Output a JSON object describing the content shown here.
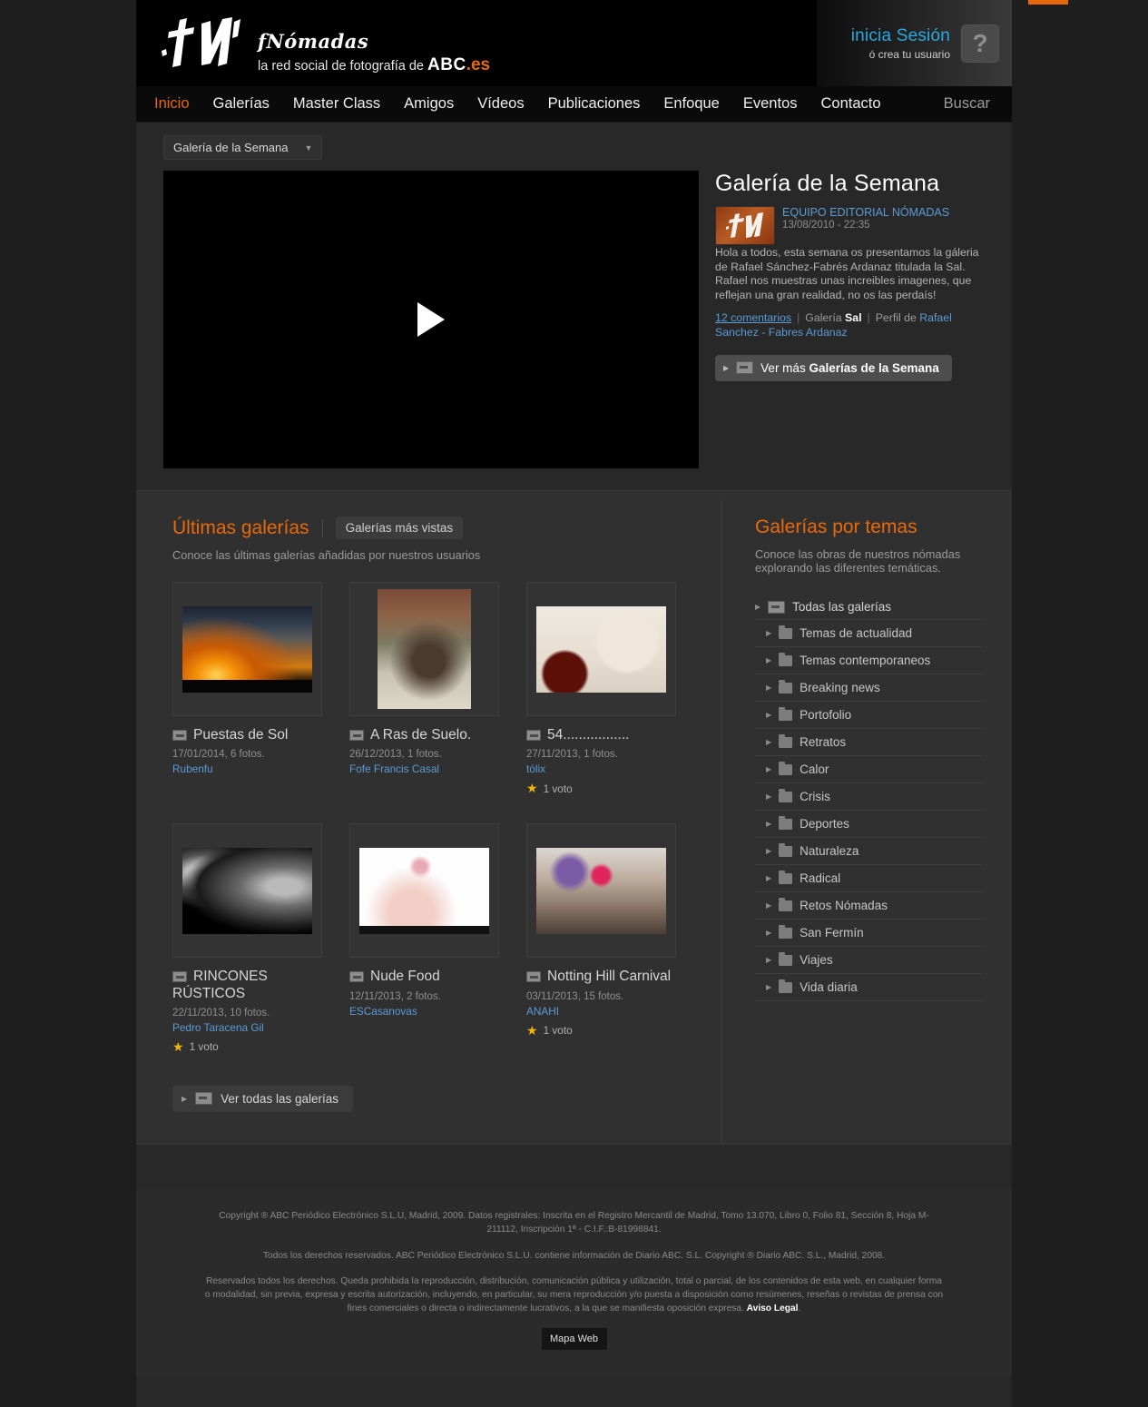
{
  "header": {
    "logo_script": "fNómadas",
    "tagline": "la red social de fotografía de",
    "brand": "ABC",
    "brand_suffix": ".es",
    "login_primary": "inicia Sesión",
    "login_secondary": "ó crea tu usuario",
    "help_glyph": "?"
  },
  "nav": {
    "items": [
      {
        "label": "Inicio",
        "active": true
      },
      {
        "label": "Galerías",
        "active": false
      },
      {
        "label": "Master Class",
        "active": false
      },
      {
        "label": "Amigos",
        "active": false
      },
      {
        "label": "Vídeos",
        "active": false
      },
      {
        "label": "Publicaciones",
        "active": false
      },
      {
        "label": "Enfoque",
        "active": false
      },
      {
        "label": "Eventos",
        "active": false
      },
      {
        "label": "Contacto",
        "active": false
      }
    ],
    "search_label": "Buscar"
  },
  "hero": {
    "selector_label": "Galería de la Semana",
    "selector_caret": "▼",
    "title": "Galería de la Semana",
    "author": "EQUIPO EDITORIAL NÓMADAS",
    "date": "13/08/2010 - 22:35",
    "body": "Hola a todos, esta semana os presentamos la gáleria de Rafael Sánchez-Fabrés Ardanaz titulada la Sal. Rafael nos muestras unas increibles imagenes, que reflejan una gran realidad, no os las perdaís!",
    "comments_link": "12 comentarios",
    "gallery_prefix": "Galería",
    "gallery_name": "Sal",
    "profile_prefix": "Perfil de",
    "profile_name": "Rafael Sanchez - Fabres Ardanaz",
    "more_button_prefix": "Ver más",
    "more_button_bold": "Galerías de la Semana"
  },
  "latest": {
    "title": "Últimas galerías",
    "tab_most_viewed": "Galerías más vistas",
    "subtitle": "Conoce las últimas galerías añadidas por nuestros usuarios",
    "view_all": "Ver todas las galerías",
    "cards": [
      {
        "title": "Puestas de Sol",
        "date": "17/01/2014, 6 fotos.",
        "user": "Rubenfu",
        "votes": "",
        "thumb": "t-sunset",
        "shape": "wide"
      },
      {
        "title": "A Ras de Suelo.",
        "date": "26/12/2013, 1 fotos.",
        "user": "Fofe Francis Casal",
        "votes": "",
        "thumb": "t-spider",
        "shape": "tall"
      },
      {
        "title": "54.................",
        "date": "27/11/2013, 1 fotos.",
        "user": "tólix",
        "votes": "1 voto",
        "thumb": "t-roses",
        "shape": "wide"
      },
      {
        "title": "RINCONES RÚSTICOS",
        "date": "22/11/2013, 10 fotos.",
        "user": "Pedro Taracena Gil",
        "votes": "1 voto",
        "thumb": "t-bricks",
        "shape": "wide"
      },
      {
        "title": "Nude Food",
        "date": "12/11/2013, 2 fotos.",
        "user": "ESCasanovas",
        "votes": "",
        "thumb": "t-nude",
        "shape": "wide"
      },
      {
        "title": "Notting Hill Carnival",
        "date": "03/11/2013, 15 fotos.",
        "user": "ANAHI",
        "votes": "1 voto",
        "thumb": "t-carnival",
        "shape": "wide"
      }
    ]
  },
  "themes": {
    "title": "Galerías por temas",
    "subtitle": "Conoce las obras de nuestros nómadas explorando las diferentes temáticas.",
    "root": "Todas las galerías",
    "items": [
      "Temas de actualidad",
      "Temas contemporaneos",
      "Breaking news",
      "Portofolio",
      "Retratos",
      "Calor",
      "Crisis",
      "Deportes",
      "Naturaleza",
      "Radical",
      "Retos Nómadas",
      "San Fermín",
      "Viajes",
      "Vida diaria"
    ]
  },
  "footer": {
    "p1": "Copyright ® ABC Periódico Electrónico S.L.U, Madrid, 2009. Datos registrales: Inscrita en el Registro Mercantil de Madrid, Tomo 13.070, Libro 0, Folio 81, Sección 8, Hoja M-211112, Inscripción 1ª - C.I.F.:B-81998841.",
    "p2": "Todos los derechos reservados. ABC Periódico Electrónico S.L.U. contiene información de Diario ABC. S.L. Copyright ® Diario ABC. S.L., Madrid, 2008.",
    "p3_main": "Reservados todos los derechos. Queda prohibida la reproducción, distribución, comunicación pública y utilización, total o parcial, de los contenidos de esta web, en cualquier forma o modalidad, sin previa, expresa y escrita autorización, incluyendo, en particular, su mera reproducción y/o puesta a disposición como resúmenes, reseñas o revistas de prensa con fines comerciales o directa o indirectamente lucrativos, a la que se manifiesta oposición expresa.",
    "p3_link": "Aviso Legal",
    "mapa_web": "Mapa Web"
  },
  "colors": {
    "accent": "#e8690b",
    "link": "#5b9bd5",
    "login": "#27a9e1",
    "star": "#f2b705"
  }
}
